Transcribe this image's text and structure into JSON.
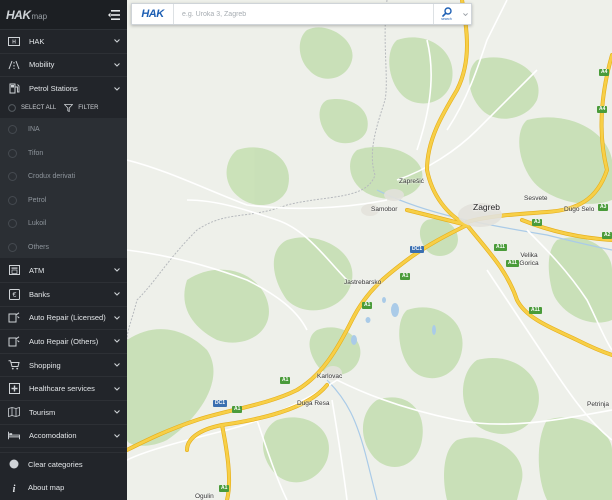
{
  "app": {
    "logo_main": "HAK",
    "logo_sub": "map"
  },
  "sidebar": {
    "categories_top": [
      {
        "label": "HAK",
        "icon": "hak-icon"
      },
      {
        "label": "Mobility",
        "icon": "road-icon"
      },
      {
        "label": "Petrol Stations",
        "icon": "fuel-pump-icon"
      }
    ],
    "select_all_label": "SELECT ALL",
    "filter_label": "FILTER",
    "brands": [
      {
        "label": "INA"
      },
      {
        "label": "Tifon"
      },
      {
        "label": "Crodux derivati"
      },
      {
        "label": "Petrol"
      },
      {
        "label": "Lukoil"
      },
      {
        "label": "Others"
      }
    ],
    "categories_bottom": [
      {
        "label": "ATM",
        "icon": "atm-icon"
      },
      {
        "label": "Banks",
        "icon": "bank-icon"
      },
      {
        "label": "Auto Repair (Licensed)",
        "icon": "wrench-icon"
      },
      {
        "label": "Auto Repair (Others)",
        "icon": "wrench-icon"
      },
      {
        "label": "Shopping",
        "icon": "cart-icon"
      },
      {
        "label": "Healthcare services",
        "icon": "medical-cross-icon"
      },
      {
        "label": "Tourism",
        "icon": "map-fold-icon"
      },
      {
        "label": "Accomodation",
        "icon": "bed-icon"
      }
    ],
    "footer": [
      {
        "label": "Clear categories",
        "icon": "circle-icon"
      },
      {
        "label": "About map",
        "icon": "info-icon"
      }
    ]
  },
  "search": {
    "brand": "HAK",
    "placeholder": "e.g. Uroka 3, Zagreb",
    "button_caption": "search"
  },
  "map": {
    "places": [
      "Zaprešić",
      "Samobor",
      "Zagreb",
      "Sesvete",
      "Dugo Selo",
      "Jastrebarsko",
      "Velika Gorica",
      "Karlovac",
      "Duga Resa",
      "Petrinja",
      "Ogulin"
    ],
    "road_labels": [
      "A1",
      "A1",
      "A1",
      "A1",
      "A1",
      "A2",
      "A3",
      "A3",
      "A4",
      "A4",
      "A11",
      "A11",
      "A11",
      "DC1",
      "DC1"
    ]
  },
  "colors": {
    "sidebar_bg": "#22252a",
    "brand_list_bg": "#2b2f34",
    "accent_blue": "#1d5fb4",
    "motorway": "#f5c739",
    "forest": "#c6dfb4",
    "water": "#aacbe8"
  }
}
